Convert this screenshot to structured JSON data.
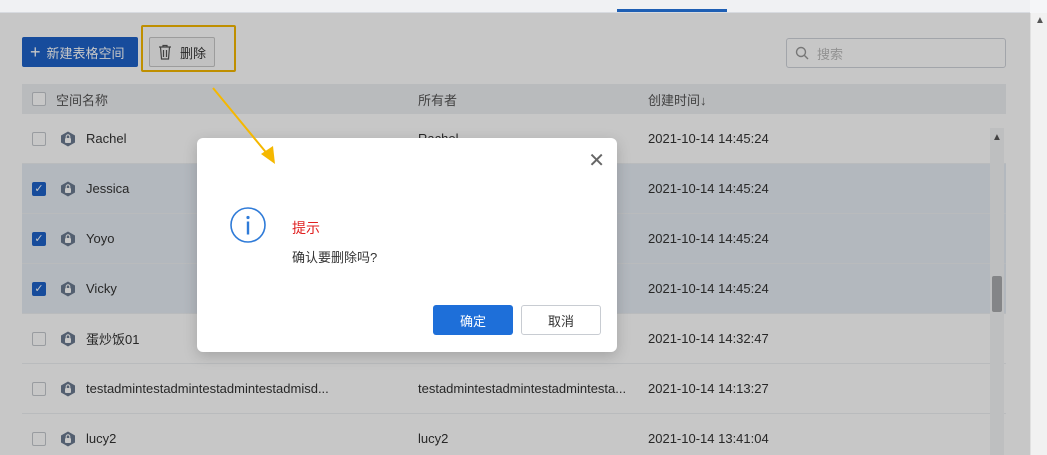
{
  "toolbar": {
    "new_label": "新建表格空间",
    "delete_label": "删除",
    "search_placeholder": "搜索"
  },
  "table": {
    "headers": [
      "空间名称",
      "所有者",
      "创建时间↓"
    ],
    "rows": [
      {
        "name": "Rachel",
        "owner": "Rachel",
        "time": "2021-10-14 14:45:24",
        "checked": false
      },
      {
        "name": "Jessica",
        "owner": "",
        "time": "2021-10-14 14:45:24",
        "checked": true
      },
      {
        "name": "Yoyo",
        "owner": "",
        "time": "2021-10-14 14:45:24",
        "checked": true
      },
      {
        "name": "Vicky",
        "owner": "",
        "time": "2021-10-14 14:45:24",
        "checked": true
      },
      {
        "name": "蛋炒饭01",
        "owner": "",
        "time": "2021-10-14 14:32:47",
        "checked": false
      },
      {
        "name": "testadmintestadmintestadmintestadmisd...",
        "owner": "testadmintestadmintestadmintesta...",
        "time": "2021-10-14 14:13:27",
        "checked": false
      },
      {
        "name": "lucy2",
        "owner": "lucy2",
        "time": "2021-10-14 13:41:04",
        "checked": false
      }
    ]
  },
  "dialog": {
    "title": "提示",
    "message": "确认要删除吗?",
    "ok_label": "确定",
    "cancel_label": "取消"
  },
  "colors": {
    "primary": "#1e62c8",
    "highlight": "#f5b800",
    "dialog_title": "#e02020"
  }
}
